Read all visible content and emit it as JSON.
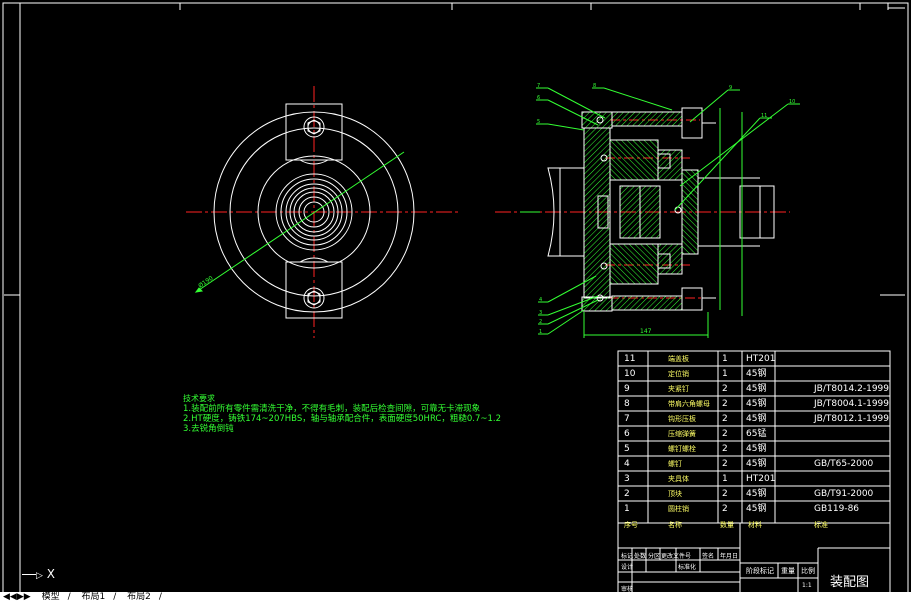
{
  "notes": {
    "heading": "技术要求",
    "lines": [
      "1.装配前所有零件需清洗干净，不得有毛刺，装配后检查间隙，可靠无卡滞现象",
      "2.HT硬度，铸铁174~207HBS，轴与轴承配合件，表面硬度50HRC，粗糙0.7~1.2",
      "3.去锐角倒钝"
    ]
  },
  "bom": {
    "rows": [
      {
        "no": "11",
        "name": "端盖板",
        "qty": "1",
        "material": "HT201",
        "std": ""
      },
      {
        "no": "10",
        "name": "定位销",
        "qty": "1",
        "material": "45钢",
        "std": ""
      },
      {
        "no": "9",
        "name": "夹紧钉",
        "qty": "2",
        "material": "45钢",
        "std": "JB/T8014.2-1999"
      },
      {
        "no": "8",
        "name": "带肩六角螺母",
        "qty": "2",
        "material": "45钢",
        "std": "JB/T8004.1-1999"
      },
      {
        "no": "7",
        "name": "钩形压板",
        "qty": "2",
        "material": "45钢",
        "std": "JB/T8012.1-1999"
      },
      {
        "no": "6",
        "name": "压缩弹簧",
        "qty": "2",
        "material": "65锰",
        "std": ""
      },
      {
        "no": "5",
        "name": "螺钉螺栓",
        "qty": "2",
        "material": "45钢",
        "std": ""
      },
      {
        "no": "4",
        "name": "螺钉",
        "qty": "2",
        "material": "45钢",
        "std": "GB/T65-2000"
      },
      {
        "no": "3",
        "name": "夹具体",
        "qty": "1",
        "material": "HT201",
        "std": ""
      },
      {
        "no": "2",
        "name": "顶块",
        "qty": "2",
        "material": "45钢",
        "std": "GB/T91-2000"
      },
      {
        "no": "1",
        "name": "圆柱销",
        "qty": "2",
        "material": "45钢",
        "std": "GB119-86"
      }
    ],
    "header": {
      "no": "序号",
      "name": "名称",
      "qty": "数量",
      "material": "材料",
      "std": "标准"
    }
  },
  "title_block": {
    "row1": [
      "标记",
      "处数",
      "分区",
      "更改文件号",
      "签名",
      "年月日"
    ],
    "row2": [
      "设计",
      "标准化",
      "",
      "阶段标记",
      "重量",
      "比例"
    ],
    "scale": "1:1",
    "row3": [
      "审核"
    ],
    "drawing_name": "装配图"
  },
  "status": {
    "ucs_label": "X",
    "tabs": [
      "模型",
      "布局1",
      "布局2"
    ]
  },
  "colors": {
    "frame": "#ffffff",
    "center": "#ff2222",
    "part": "#ffffff",
    "hatch": "#33ff33",
    "leader": "#33ff33",
    "dim": "#33ff33",
    "notes": "#33ff33",
    "bomText": "#ffff66"
  },
  "dimensions": {
    "overall_length": "147",
    "diameter_label": "Ø190"
  },
  "balloons": [
    "7",
    "6",
    "5",
    "4",
    "3",
    "2",
    "1",
    "8",
    "9",
    "10",
    "11"
  ]
}
